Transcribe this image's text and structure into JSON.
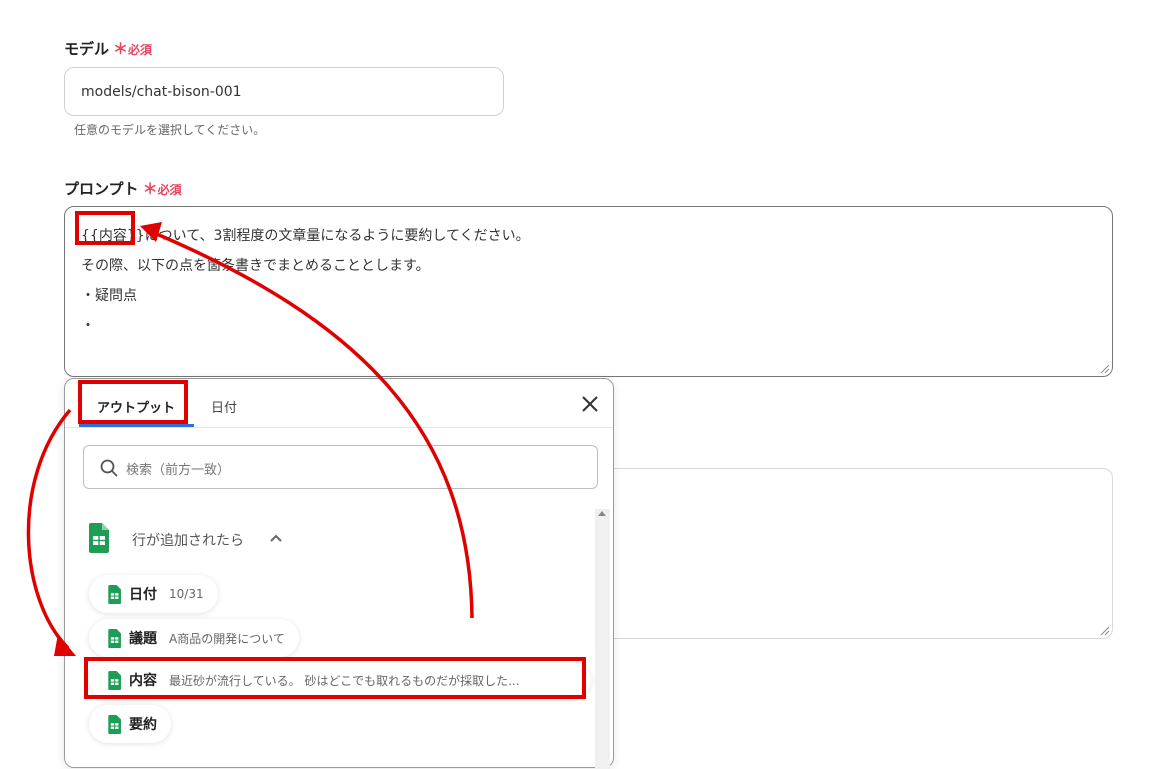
{
  "model_field": {
    "label": "モデル",
    "required_mark": "＊",
    "required_text": "必須",
    "value": "models/chat-bison-001",
    "hint": "任意のモデルを選択してください。"
  },
  "prompt_field": {
    "label": "プロンプト",
    "required_mark": "＊",
    "required_text": "必須",
    "lines": [
      "{{内容}}について、3割程度の文章量になるように要約してください。",
      "その際、以下の点を箇条書きでまとめることとします。",
      "・疑問点",
      "・"
    ]
  },
  "popup": {
    "tabs": [
      {
        "label": "アウトプット",
        "active": true
      },
      {
        "label": "日付",
        "active": false
      }
    ],
    "search_placeholder": "検索（前方一致）",
    "group_label": "行が追加されたら",
    "items": [
      {
        "key": "日付",
        "value": "10/31"
      },
      {
        "key": "議題",
        "value": "A商品の開発について"
      },
      {
        "key": "内容",
        "value": "最近砂が流行している。 砂はどこでも取れるものだが採取した..."
      },
      {
        "key": "要約",
        "value": ""
      }
    ]
  },
  "icons": {
    "sheets": "google-sheets-icon",
    "search": "search-icon",
    "close": "close-icon",
    "chevron": "chevron-up-icon"
  },
  "colors": {
    "required": "#e5455f",
    "annotation_red": "#e00000",
    "sheets_green": "#1e9d57",
    "tab_underline": "#2f6fe0"
  }
}
